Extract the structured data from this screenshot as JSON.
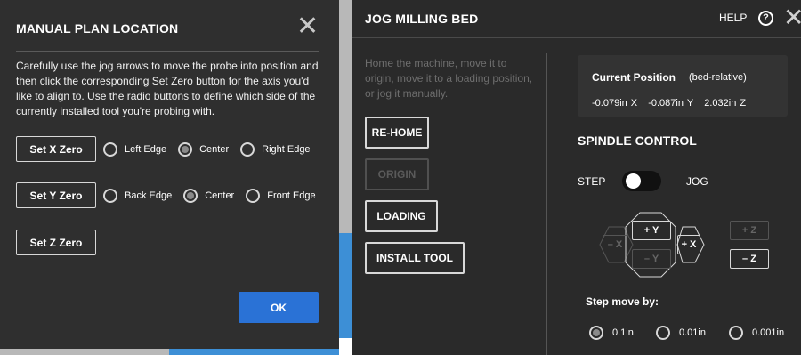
{
  "modal": {
    "title": "MANUAL PLAN LOCATION",
    "close_glyph": "✕",
    "description": "Carefully use the jog arrows to move the probe into position and then click the corresponding Set Zero button for the axis you'd like to align to. Use the radio buttons to define which side of the currently installed tool you're probing with.",
    "rows": [
      {
        "button": "Set X Zero",
        "options": [
          "Left Edge",
          "Center",
          "Right Edge"
        ],
        "selected": "Center"
      },
      {
        "button": "Set Y Zero",
        "options": [
          "Back Edge",
          "Center",
          "Front Edge"
        ],
        "selected": "Center"
      },
      {
        "button": "Set Z Zero"
      }
    ],
    "ok_label": "OK"
  },
  "jog": {
    "title": "JOG MILLING BED",
    "help_label": "HELP",
    "help_glyph": "?",
    "close_glyph": "✕",
    "description": "Home the machine, move it to origin, move it to a loading position, or jog it manually.",
    "buttons": [
      {
        "label": "RE-HOME",
        "enabled": true
      },
      {
        "label": "ORIGIN",
        "enabled": false
      },
      {
        "label": "LOADING",
        "enabled": true
      },
      {
        "label": "INSTALL TOOL",
        "enabled": true
      }
    ],
    "position": {
      "title": "Current Position",
      "qualifier": "(bed-relative)",
      "x": "-0.079in X",
      "y": "-0.087in Y",
      "z": "2.032in Z"
    },
    "spindle_title": "SPINDLE CONTROL",
    "step_label": "STEP",
    "jog_label": "JOG",
    "toggle_state": "STEP",
    "pad": {
      "minus_x": "– X",
      "plus_y": "+ Y",
      "minus_y": "– Y",
      "plus_x": "+ X",
      "plus_z": "+ Z",
      "minus_z": "– Z"
    },
    "step_move_label": "Step move by:",
    "step_options": [
      "0.1in",
      "0.01in",
      "0.001in"
    ],
    "step_selected": "0.1in"
  }
}
